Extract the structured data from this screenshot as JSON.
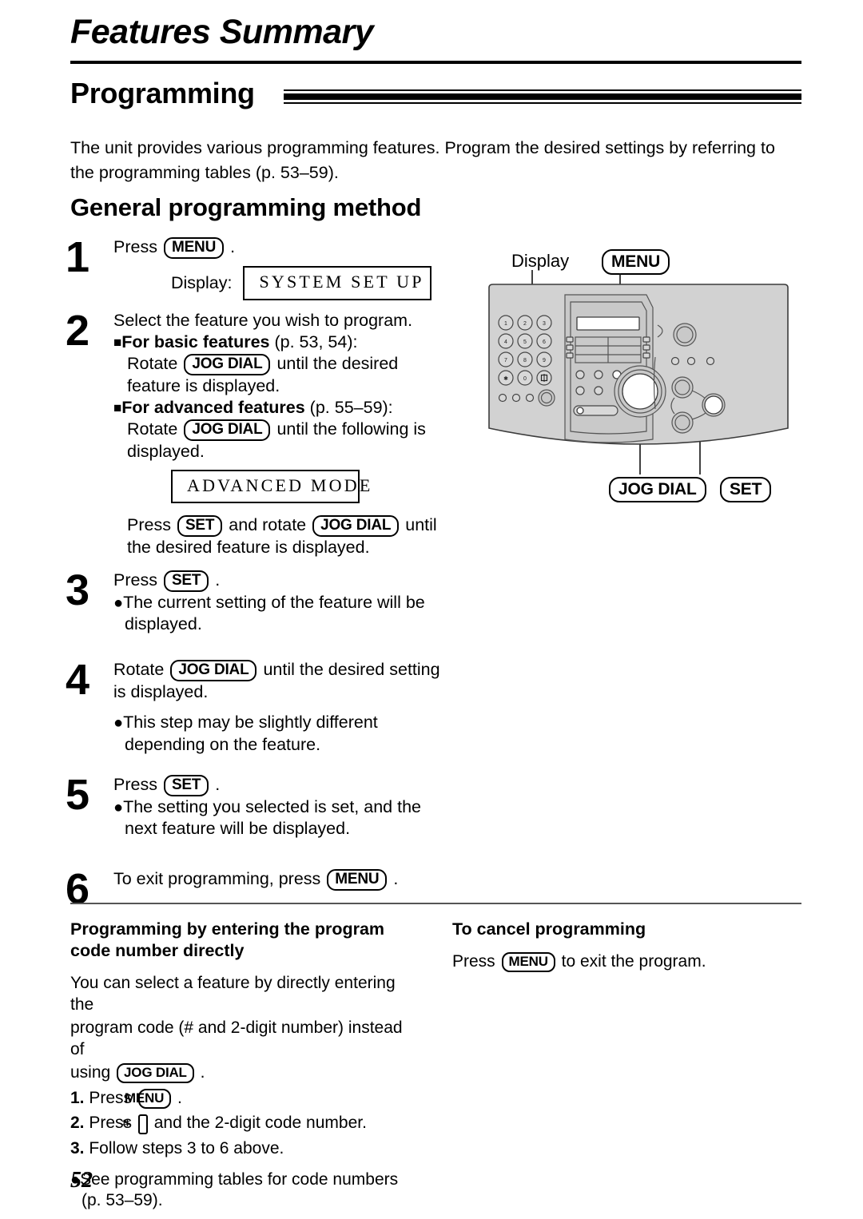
{
  "header": {
    "chapter_title": "Features Summary",
    "section_title": "Programming"
  },
  "intro": {
    "paragraph": "The unit provides various programming features. Program the desired settings by referring to the programming tables (p. 53–59)."
  },
  "subhead": "General programming method",
  "steps": [
    {
      "num": "1",
      "line1_pre": "Press",
      "key1": "MENU",
      "line1_post": ".",
      "display_label": "Display:",
      "lcd": "SYSTEM SET UP"
    },
    {
      "num": "2",
      "intro": "Select the feature you wish to program.",
      "basic_head": "For basic features",
      "basic_ref": " (p. 53, 54):",
      "basic_pre": "Rotate",
      "basic_key": "JOG DIAL",
      "basic_post": "until the desired",
      "basic_cont": "feature is displayed.",
      "adv_head": "For advanced features",
      "adv_ref": " (p. 55–59):",
      "adv_pre": "Rotate",
      "adv_key": "JOG DIAL",
      "adv_post": "until the following is",
      "adv_cont": "displayed.",
      "lcd": "ADVANCED MODE",
      "tail_pre": "Press",
      "tail_key1": "SET",
      "tail_mid": "and rotate",
      "tail_key2": "JOG DIAL",
      "tail_post": "until",
      "tail_cont": "the desired feature is displayed."
    },
    {
      "num": "3",
      "line1_pre": "Press",
      "key1": "SET",
      "line1_post": ".",
      "bullet1": "The current setting of the feature will be",
      "bullet1_cont": "displayed."
    },
    {
      "num": "4",
      "line1_pre": "Rotate",
      "key1": "JOG DIAL",
      "line1_post": "until the desired setting",
      "line2": "is displayed.",
      "bullet1": "This step may be slightly different",
      "bullet1_cont": "depending on the feature."
    },
    {
      "num": "5",
      "line1_pre": "Press",
      "key1": "SET",
      "line1_post": ".",
      "bullet1": "The setting you selected is set, and the",
      "bullet1_cont": "next feature will be displayed."
    },
    {
      "num": "6",
      "line1_pre": "To exit programming, press",
      "key1": "MENU",
      "line1_post": "."
    }
  ],
  "machine": {
    "label_display": "Display",
    "label_menu": "MENU",
    "label_jog_dial": "JOG DIAL",
    "label_set": "SET",
    "keypad": [
      "1",
      "2",
      "3",
      "4",
      "5",
      "6",
      "7",
      "8",
      "9",
      "✱",
      "0",
      "⌗"
    ],
    "panel_color": "#d2d2d2",
    "outline_color": "#3c3c3c"
  },
  "bottom": {
    "left": {
      "heading_line1": "Programming by entering the program",
      "heading_line2": "code number directly",
      "para_line1": "You can select a feature by directly entering the",
      "para_line2": "program code (# and 2-digit number) instead of",
      "para_line3_pre": "using",
      "para_line3_key": "JOG DIAL",
      "para_line3_post": ".",
      "item1_num": "1.",
      "item1_pre": "Press",
      "item1_key": "MENU",
      "item1_post": ".",
      "item2_num": "2.",
      "item2_pre": "Press",
      "item2_key": "⌗",
      "item2_post": "and the 2-digit code number.",
      "item3_num": "3.",
      "item3_text": "Follow steps 3 to 6 above.",
      "bullet_line1": "See programming tables for code numbers",
      "bullet_line2": "(p. 53–59)."
    },
    "right": {
      "heading": "To cancel programming",
      "para_pre": "Press",
      "para_key": "MENU",
      "para_post": "to exit the program."
    }
  },
  "page_number": "52"
}
